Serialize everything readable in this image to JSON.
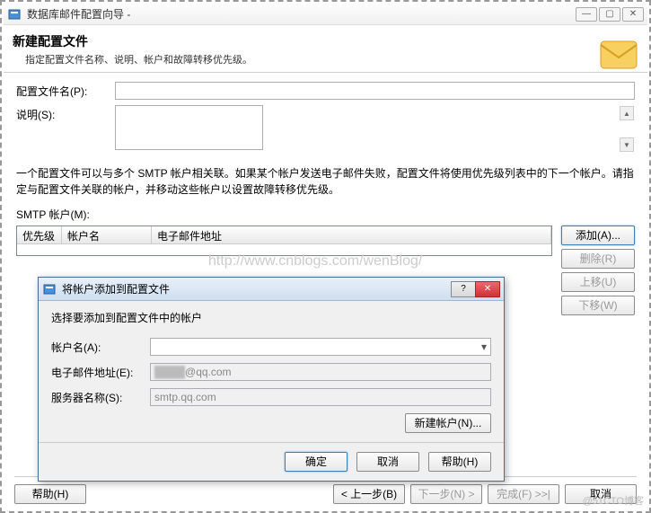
{
  "main": {
    "title": "数据库邮件配置向导 -",
    "header_title": "新建配置文件",
    "header_subtitle": "指定配置文件名称、说明、帐户和故障转移优先级。",
    "profile_name_label": "配置文件名(P):",
    "profile_name_value": "",
    "description_label": "说明(S):",
    "description_value": "",
    "info_text": "一个配置文件可以与多个 SMTP 帐户相关联。如果某个帐户发送电子邮件失败，配置文件将使用优先级列表中的下一个帐户。请指定与配置文件关联的帐户，并移动这些帐户以设置故障转移优先级。",
    "smtp_label": "SMTP 帐户(M):",
    "table": {
      "col_priority": "优先级",
      "col_name": "帐户名",
      "col_email": "电子邮件地址"
    },
    "side": {
      "add": "添加(A)...",
      "remove": "删除(R)",
      "up": "上移(U)",
      "down": "下移(W)"
    },
    "bottom": {
      "help": "帮助(H)",
      "back": "< 上一步(B)",
      "next": "下一步(N) >",
      "finish": "完成(F) >>|",
      "cancel": "取消"
    }
  },
  "dialog": {
    "title": "将帐户添加到配置文件",
    "instruction": "选择要添加到配置文件中的帐户",
    "account_label": "帐户名(A):",
    "account_value": "",
    "email_label": "电子邮件地址(E):",
    "email_value": "@qq.com",
    "server_label": "服务器名称(S):",
    "server_value": "smtp.qq.com",
    "new_account": "新建帐户(N)...",
    "ok": "确定",
    "cancel": "取消",
    "help": "帮助(H)"
  },
  "watermark": "http://www.cnblogs.com/wenBlog/",
  "corner_watermark": "@51CTO博客"
}
